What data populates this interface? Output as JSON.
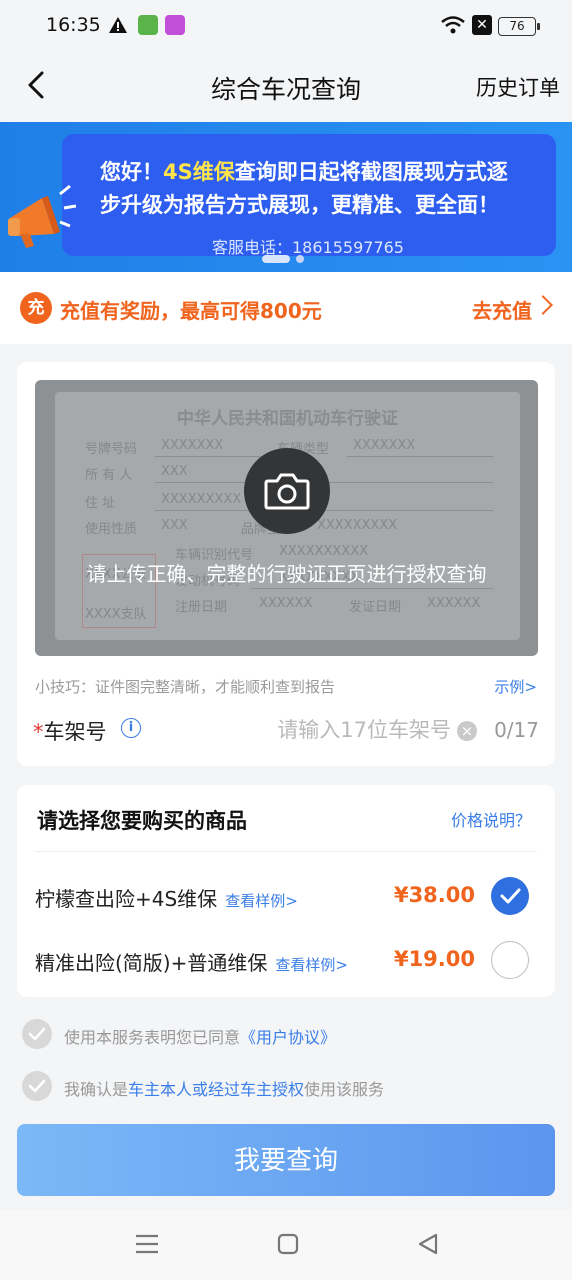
{
  "status_bar": {
    "time": "16:35",
    "battery": "76"
  },
  "nav": {
    "title": "综合车况查询",
    "history": "历史订单"
  },
  "banner": {
    "line1_a": "您好！",
    "line1_hl": "4S维保",
    "line1_b": "查询即日起将截图展现方式逐",
    "line2": "步升级为报告方式展现，更精准、更全面！",
    "phone": "客服电话：18615597765"
  },
  "recharge": {
    "badge": "充",
    "text": "充值有奖励，最高可得800元",
    "action": "去充值"
  },
  "license": {
    "title": "中华人民共和国机动车行驶证",
    "r1": "号牌号码",
    "r1v": "XXXXXXX",
    "r1b": "车辆类型",
    "r1bv": "XXXXXXX",
    "r2": "所 有 人",
    "r2v": "XXX",
    "r3": "住    址",
    "r3v": "XXXXXXXXX",
    "r4": "使用性质",
    "r4v": "XXX",
    "r4b": "品牌型号",
    "r4bv": "XXXXXXXXX",
    "r5": "车辆识别代号",
    "r5v": "XXXXXXXXXX",
    "r6": "发动机号码",
    "r6v": "XXXXXXXXX",
    "r7": "注册日期",
    "r7v": "XXXXXX",
    "r7b": "发证日期",
    "r7bv": "XXXXXX",
    "stamp1": "XXXX公安",
    "stamp2": "XXXX支队"
  },
  "upload": {
    "hint": "请上传正确、完整的行驶证正页进行授权查询",
    "tip": "小技巧：证件图完整清晰，才能顺利查到报告",
    "example": "示例>"
  },
  "vin": {
    "required_mark": "*",
    "label": "车架号",
    "info": "i",
    "placeholder": "请输入17位车架号",
    "clear": "×",
    "count": "0/17"
  },
  "products": {
    "title": "请选择您要购买的商品",
    "price_explain": "价格说明？",
    "items": [
      {
        "name": "柠檬查出险+4S维保",
        "sample": "查看样例>",
        "price": "¥38.00",
        "selected": true
      },
      {
        "name": "精准出险(简版)+普通维保",
        "sample": "查看样例>",
        "price": "¥19.00",
        "selected": false
      }
    ]
  },
  "agreements": {
    "a1_pre": "使用本服务表明您已同意",
    "a1_link": "《用户协议》",
    "a2_pre": "我确认是",
    "a2_link": "车主本人或经过车主授权",
    "a2_post": "使用该服务"
  },
  "submit": "我要查询",
  "colors": {
    "accent": "#2f6fe0",
    "orange": "#f0641e",
    "banner": "#2d5ef0"
  }
}
